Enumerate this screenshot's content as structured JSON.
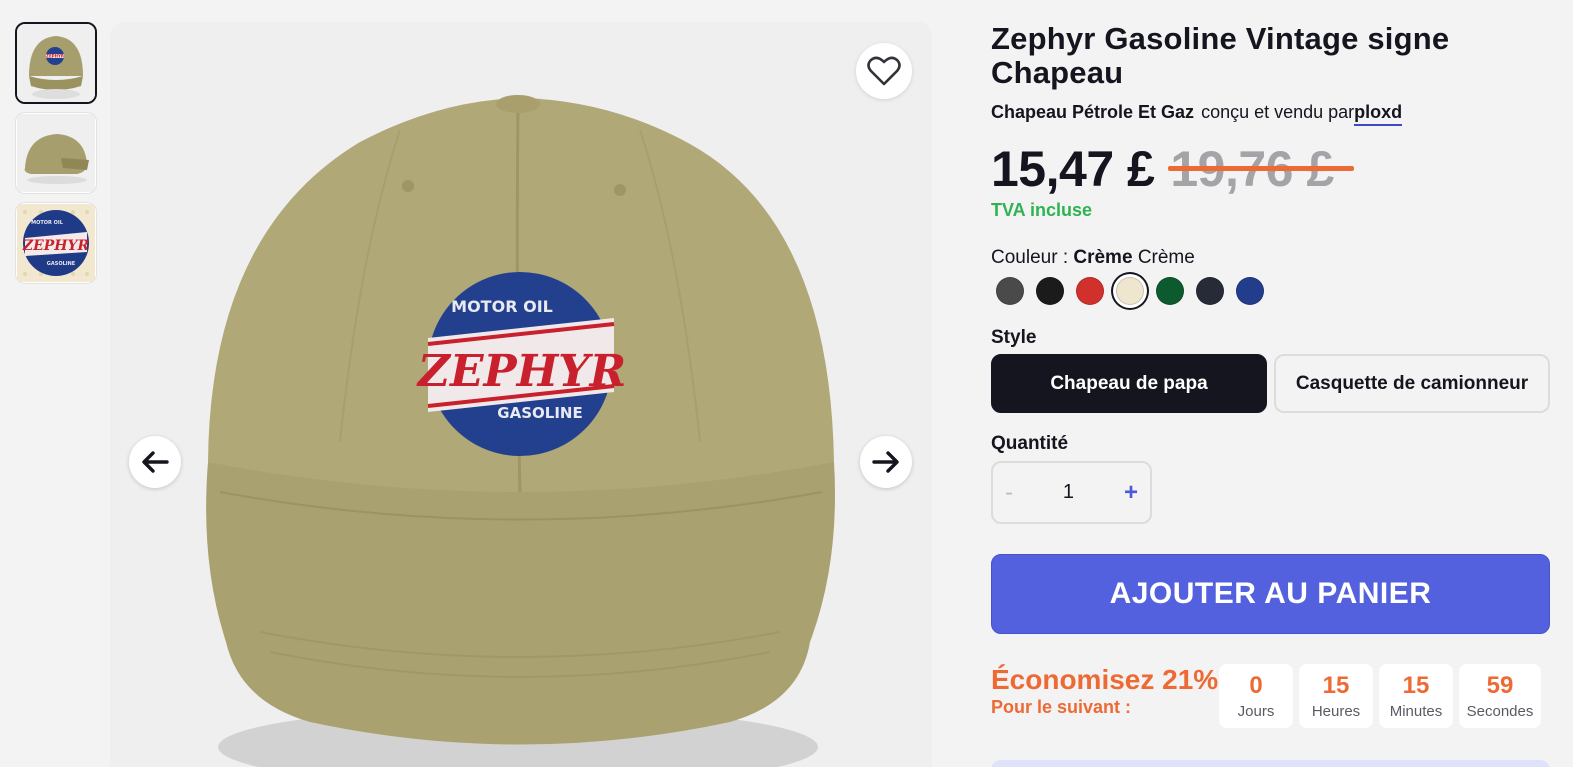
{
  "gallery": {
    "thumbnails": [
      {
        "icon": "cap-front-thumbnail"
      },
      {
        "icon": "cap-back-thumbnail"
      },
      {
        "icon": "sticker-design-thumbnail"
      }
    ],
    "main_image": {
      "badge_top": "MOTOR OIL",
      "badge_main": "ZEPHYR",
      "badge_bottom": "GASOLINE"
    },
    "thumb_badge": {
      "top": "MOTOR OIL",
      "main": "ZEPHYR",
      "bottom": "GASOLINE"
    }
  },
  "product": {
    "title": "Zephyr Gasoline Vintage signe Chapeau",
    "category": "Chapeau Pétrole Et Gaz",
    "designed_by_text": "conçu et vendu par",
    "designer": "ploxd",
    "price": "15,47 £",
    "old_price": "19,76 £",
    "vat_note": "TVA incluse"
  },
  "color": {
    "label": "Couleur : ",
    "selected_bold": "Crème",
    "selected_name": "Crème",
    "swatches": [
      "#4a4a4a",
      "#1b1b1b",
      "#d0312d",
      "#efe6d0",
      "#0e5a2f",
      "#272b38",
      "#223d8c"
    ],
    "selected_index": 3
  },
  "style": {
    "label": "Style",
    "options": [
      "Chapeau de papa",
      "Casquette de camionneur"
    ],
    "selected_index": 0
  },
  "quantity": {
    "label": "Quantité",
    "value": "1",
    "minus": "-",
    "plus": "+"
  },
  "cart": {
    "button_label": "AJOUTER AU PANIER"
  },
  "promo": {
    "save_text": "Économisez 21%",
    "next_text": "Pour le suivant :",
    "timer": [
      {
        "value": "0",
        "unit": "Jours"
      },
      {
        "value": "15",
        "unit": "Heures"
      },
      {
        "value": "15",
        "unit": "Minutes"
      },
      {
        "value": "59",
        "unit": "Secondes"
      }
    ]
  },
  "colors": {
    "accent": "#5461de",
    "promo": "#ee6a35",
    "vat_green": "#2fb352",
    "text": "#15151f"
  }
}
